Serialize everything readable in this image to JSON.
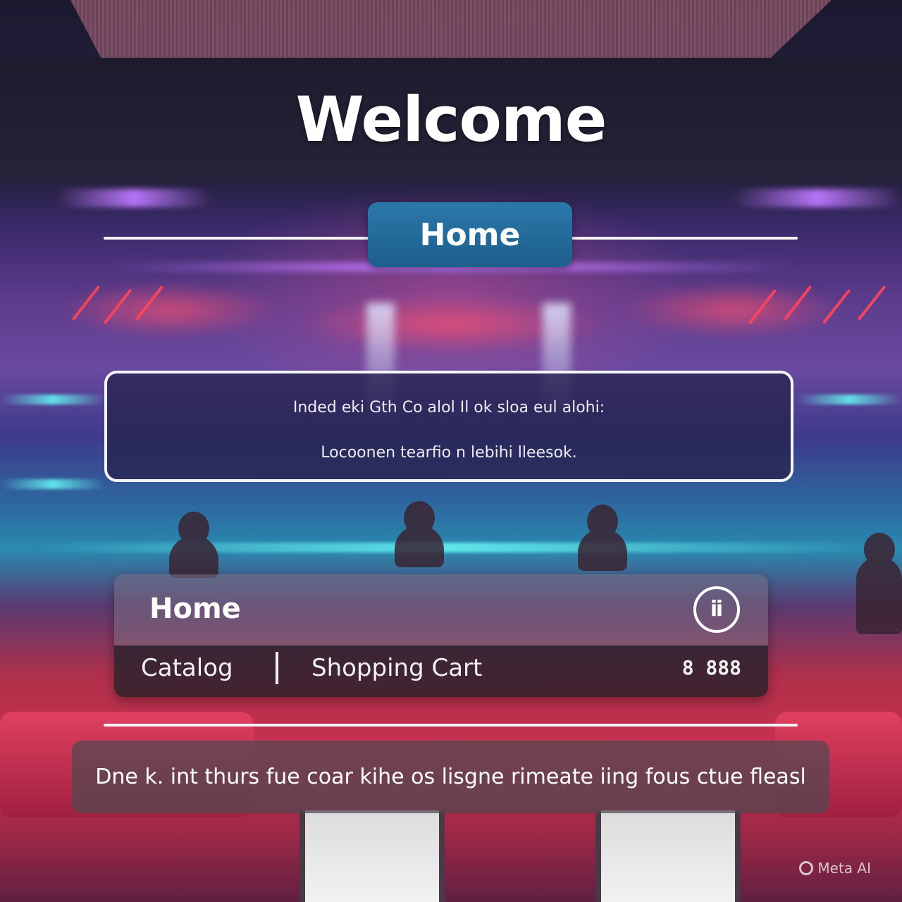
{
  "header": {
    "title": "Welcome"
  },
  "primary_button": {
    "label": "Home"
  },
  "info_panel": {
    "line1": "Inded eki Gth Co alol Il ok sloa eul alohi:",
    "line2": "Locoonen tearfio n lebihi lleesok."
  },
  "nav_card": {
    "title": "Home",
    "icon": "user-circle-icon",
    "links": [
      {
        "label": "Catalog"
      },
      {
        "label": "Shopping Cart"
      }
    ],
    "count": "8 888"
  },
  "banner": {
    "text": "Dne k. int thurs fue coar kihe os lisgne rimeate iing fous ctue fleasl"
  },
  "watermark": {
    "text": "Meta AI"
  },
  "colors": {
    "accent": "#1d5f8c",
    "text": "#ffffff",
    "divider": "#f2f2f5"
  }
}
